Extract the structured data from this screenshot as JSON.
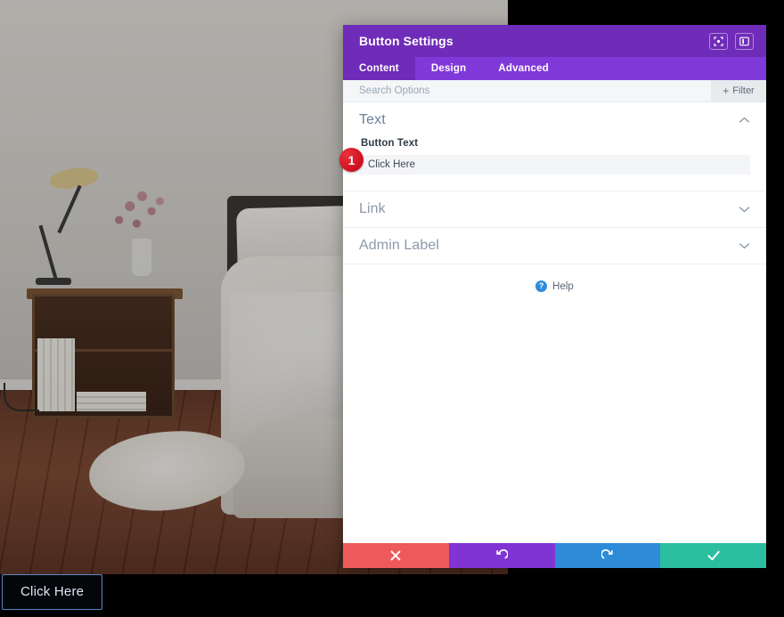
{
  "window": {
    "title": "Button Settings",
    "header_icons": [
      {
        "name": "fullscreen-icon",
        "label": "Expand"
      },
      {
        "name": "layout-panel-icon",
        "label": "Change Layout"
      }
    ]
  },
  "tabs": [
    {
      "id": "content",
      "label": "Content",
      "active": true
    },
    {
      "id": "design",
      "label": "Design",
      "active": false
    },
    {
      "id": "advanced",
      "label": "Advanced",
      "active": false
    }
  ],
  "search": {
    "placeholder": "Search Options",
    "value": "",
    "filter_label": "Filter",
    "filter_plus": "+"
  },
  "sections": [
    {
      "id": "text",
      "title": "Text",
      "open": true,
      "fields": [
        {
          "id": "button-text",
          "label": "Button Text",
          "value": "Click Here",
          "placeholder": ""
        }
      ]
    },
    {
      "id": "link",
      "title": "Link",
      "open": false
    },
    {
      "id": "admin-label",
      "title": "Admin Label",
      "open": false
    }
  ],
  "help": {
    "icon_glyph": "?",
    "label": "Help"
  },
  "footer_actions": [
    {
      "id": "cancel",
      "name": "cancel-button",
      "glyph": "x",
      "color": "#ed5a5a"
    },
    {
      "id": "undo",
      "name": "undo-button",
      "glyph": "undo",
      "color": "#8034d4"
    },
    {
      "id": "redo",
      "name": "redo-button",
      "glyph": "redo",
      "color": "#2d8bd8"
    },
    {
      "id": "save",
      "name": "save-button",
      "glyph": "check",
      "color": "#2bbfa0"
    }
  ],
  "marker": {
    "number": "1"
  },
  "page": {
    "button_label": "Click Here"
  },
  "colors": {
    "header_purple": "#6f2cb8",
    "tab_purple": "#8039d9",
    "accent_blue": "#2d8bd8",
    "marker_red": "#cf1020",
    "cancel_red": "#ed5a5a",
    "undo_purple": "#8034d4",
    "redo_blue": "#2d8bd8",
    "save_green": "#2bbfa0"
  }
}
